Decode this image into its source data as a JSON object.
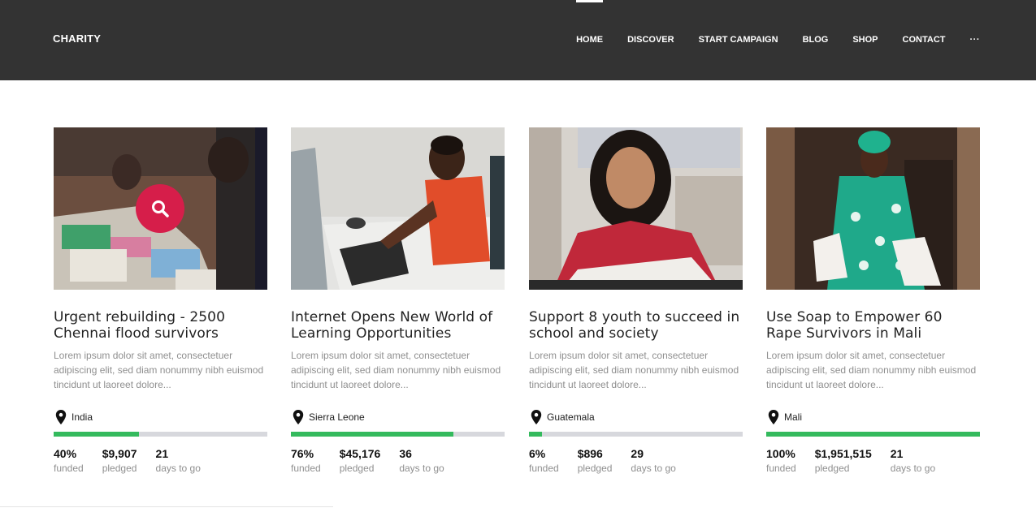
{
  "header": {
    "logo": "CHARITY",
    "nav": [
      "HOME",
      "DISCOVER",
      "START CAMPAIGN",
      "BLOG",
      "SHOP",
      "CONTACT"
    ],
    "more": "···"
  },
  "cards": [
    {
      "title": "Urgent rebuilding - 2500 Chennai flood survivors",
      "desc": "Lorem ipsum dolor sit amet, consectetuer adipiscing elit, sed diam nonummy nibh euismod tincidunt ut laoreet dolore...",
      "location": "India",
      "progress": 0.4,
      "funded": "40%",
      "funded_label": "funded",
      "pledged": "$9,907",
      "pledged_label": "pledged",
      "days": "21",
      "days_label": "days to go"
    },
    {
      "title": "Internet Opens New World of Learning Opportunities",
      "desc": "Lorem ipsum dolor sit amet, consectetuer adipiscing elit, sed diam nonummy nibh euismod tincidunt ut laoreet dolore...",
      "location": "Sierra Leone",
      "progress": 0.76,
      "funded": "76%",
      "funded_label": "funded",
      "pledged": "$45,176",
      "pledged_label": "pledged",
      "days": "36",
      "days_label": "days to go"
    },
    {
      "title": "Support 8 youth to succeed in school and society",
      "desc": "Lorem ipsum dolor sit amet, consectetuer adipiscing elit, sed diam nonummy nibh euismod tincidunt ut laoreet dolore...",
      "location": "Guatemala",
      "progress": 0.06,
      "funded": "6%",
      "funded_label": "funded",
      "pledged": "$896",
      "pledged_label": "pledged",
      "days": "29",
      "days_label": "days to go"
    },
    {
      "title": "Use Soap to Empower 60 Rape Survivors in Mali",
      "desc": "Lorem ipsum dolor sit amet, consectetuer adipiscing elit, sed diam nonummy nibh euismod tincidunt ut laoreet dolore...",
      "location": "Mali",
      "progress": 1.0,
      "funded": "100%",
      "funded_label": "funded",
      "pledged": "$1,951,515",
      "pledged_label": "pledged",
      "days": "21",
      "days_label": "days to go"
    }
  ],
  "colors": {
    "header_bg": "#333333",
    "accent": "#d61e4a",
    "progress_fill": "#34ba5d",
    "progress_track": "#d7d8dd"
  },
  "icons": {
    "zoom": "search-icon",
    "location": "map-pin-icon"
  }
}
